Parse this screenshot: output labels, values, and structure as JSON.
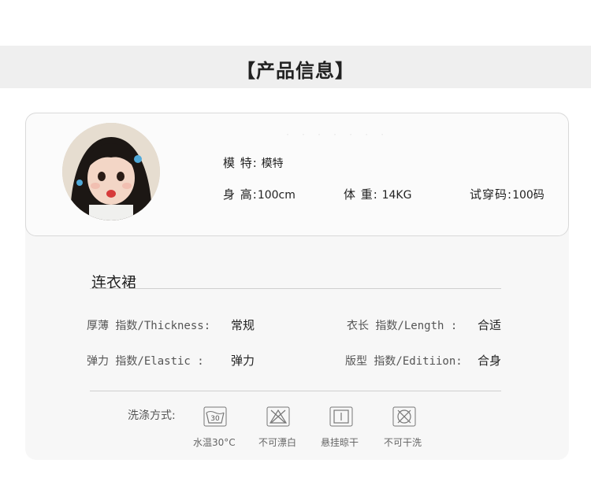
{
  "header": {
    "title": "【产品信息】"
  },
  "model_info": {
    "model_key": "模  特:",
    "model_value": "模特",
    "height_key": "身  高:",
    "height_value": "100cm",
    "weight_key": "体  重:",
    "weight_value": "14KG",
    "trysize_key": "试穿码:",
    "trysize_value": "100码"
  },
  "product": {
    "name": "连衣裙"
  },
  "specs": {
    "thickness_label": "厚薄 指数/Thickness:",
    "thickness_value": "常规",
    "length_label": "衣长 指数/Length :",
    "length_value": "合适",
    "elastic_label": "弹力 指数/Elastic :",
    "elastic_value": "弹力",
    "edition_label": "版型 指数/Editiion:",
    "edition_value": "合身"
  },
  "wash": {
    "label": "洗涤方式:",
    "items": [
      {
        "icon": "wash-30-icon",
        "temp": "30",
        "caption": "水温30°C"
      },
      {
        "icon": "no-bleach-icon",
        "caption": "不可漂白"
      },
      {
        "icon": "hang-dry-icon",
        "caption": "悬挂晾干"
      },
      {
        "icon": "no-dry-clean-icon",
        "caption": "不可干洗"
      }
    ]
  }
}
